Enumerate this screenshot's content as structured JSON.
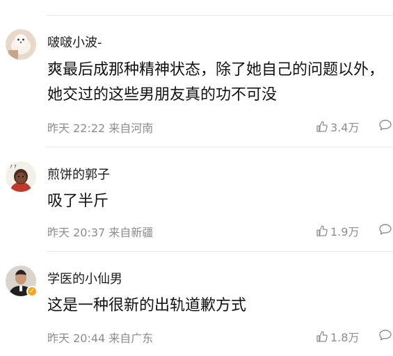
{
  "comments": [
    {
      "username": "啵啵小波-",
      "content": "爽最后成那种精神状态，除了她自己的问题以外，她交过的这些男朋友真的功不可没",
      "timestamp": "昨天 22:22 来自河南",
      "likes": "3.4万",
      "avatar_icon": "avatar-icon",
      "verified": false
    },
    {
      "username": "煎饼的郭子",
      "content": "吸了半斤",
      "timestamp": "昨天 20:37 来自新疆",
      "likes": "1.9万",
      "avatar_icon": "avatar-icon",
      "verified": false
    },
    {
      "username": "学医的小仙男",
      "content": "这是一种很新的出轨道歉方式",
      "timestamp": "昨天 20:44 来自广东",
      "likes": "1.8万",
      "avatar_icon": "avatar-icon",
      "verified": true
    }
  ],
  "colors": {
    "text": "#111111",
    "meta": "#8c8c8c",
    "divider": "#e6e6e6",
    "verified_badge": "#f5a623"
  }
}
